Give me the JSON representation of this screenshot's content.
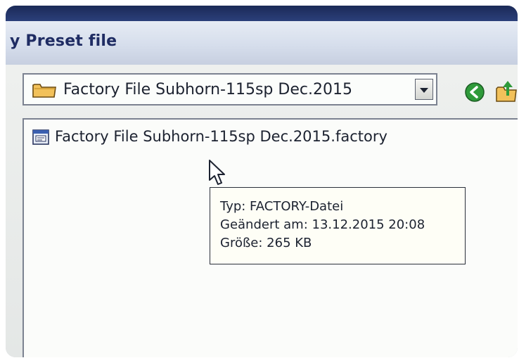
{
  "window": {
    "title": "y Preset file"
  },
  "location": {
    "value": "Factory File Subhorn-115sp Dec.2015"
  },
  "toolbar": {
    "back_icon": "back-arrow-icon",
    "up_icon": "up-folder-icon"
  },
  "files": [
    {
      "name": "Factory File Subhorn-115sp Dec.2015.factory",
      "icon": "factory-file-icon"
    }
  ],
  "tooltip": {
    "type": "Typ: FACTORY-Datei",
    "modified": "Geändert am: 13.12.2015 20:08",
    "size": "Größe: 265 KB"
  },
  "colors": {
    "title": "#1f2c63",
    "back_button": "#2f9a3a"
  }
}
